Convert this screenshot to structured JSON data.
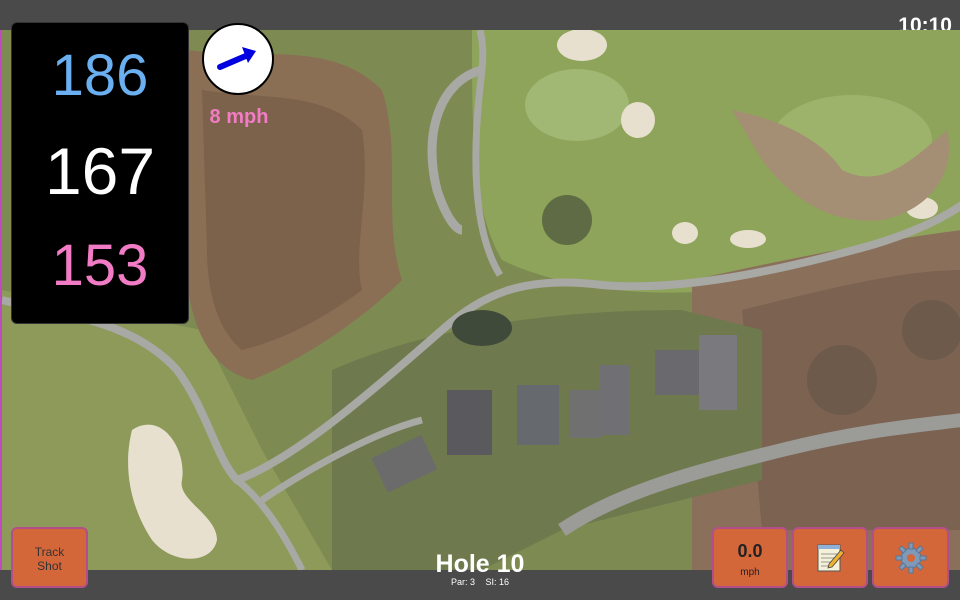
{
  "status": {
    "time": "10:10"
  },
  "distances": {
    "back": "186",
    "middle": "167",
    "front": "153"
  },
  "wind": {
    "speed_label": "8 mph",
    "direction_icon": "wind-arrow-icon"
  },
  "hole": {
    "title": "Hole 10",
    "par": "Par: 3",
    "si": "SI: 16"
  },
  "buttons": {
    "track_shot_line1": "Track",
    "track_shot_line2": "Shot",
    "wind_value": "0.0",
    "wind_unit": "mph",
    "notes_icon": "notepad-icon",
    "settings_icon": "gear-icon"
  },
  "colors": {
    "back_distance": "#6ab0f0",
    "middle_distance": "#ffffff",
    "front_distance": "#f27bc5",
    "button_fill": "#d4673a",
    "accent_border": "#b24f8b"
  }
}
